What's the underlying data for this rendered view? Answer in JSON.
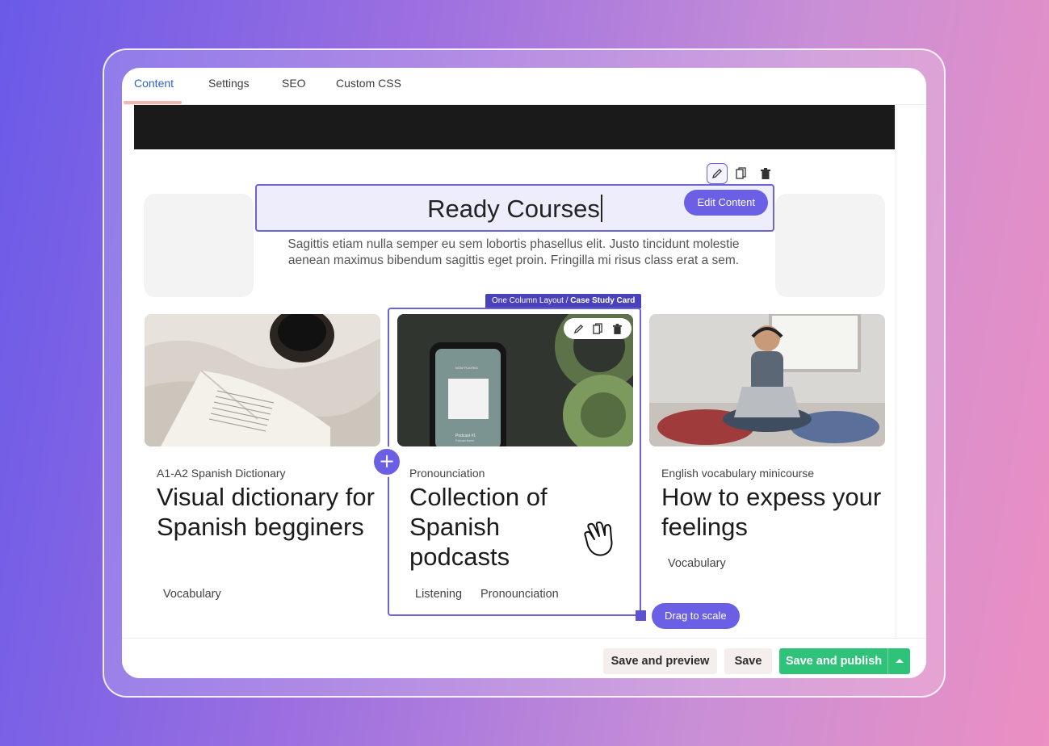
{
  "tabs": [
    {
      "label": "Content",
      "active": true
    },
    {
      "label": "Settings",
      "active": false
    },
    {
      "label": "SEO",
      "active": false
    },
    {
      "label": "Custom CSS",
      "active": false
    }
  ],
  "section": {
    "title": "Ready Courses",
    "edit_content_label": "Edit Content",
    "subtitle": "Sagittis etiam nulla semper eu sem lobortis phasellus elit. Justo tincidunt molestie aenean maximus bibendum sagittis eget proin. Fringilla mi risus class erat a sem."
  },
  "breadcrumb": {
    "layout": "One Column Layout",
    "separator": "/",
    "component": "Case Study Card"
  },
  "cards": [
    {
      "category": "A1-A2 Spanish Dictionary",
      "title": "Visual dictionary for Spanish begginers",
      "tags": [
        "Vocabulary"
      ],
      "image_icon": "book-coffee-photo"
    },
    {
      "category": "Pronounciation",
      "title": "Collection of Spanish podcasts",
      "tags": [
        "Listening",
        "Pronounciation"
      ],
      "image_icon": "phone-headphones-photo",
      "phone_screen": {
        "now_playing": "NOW PLAYING",
        "track": "Podcast #1",
        "subtitle": "Podcast Name"
      }
    },
    {
      "category": "English vocabulary minicourse",
      "title": "How to expess your feelings",
      "tags": [
        "Vocabulary"
      ],
      "image_icon": "girl-laptop-photo"
    }
  ],
  "canvas": {
    "add_icon": "+",
    "drag_label": "Drag to scale"
  },
  "footer": {
    "save_preview_label": "Save and preview",
    "save_label": "Save",
    "save_publish_label": "Save and publish"
  },
  "colors": {
    "accent": "#6b5fe6",
    "selection": "#6b63d9",
    "publish": "#2fc37a",
    "active_tab": "#2f62c8"
  }
}
